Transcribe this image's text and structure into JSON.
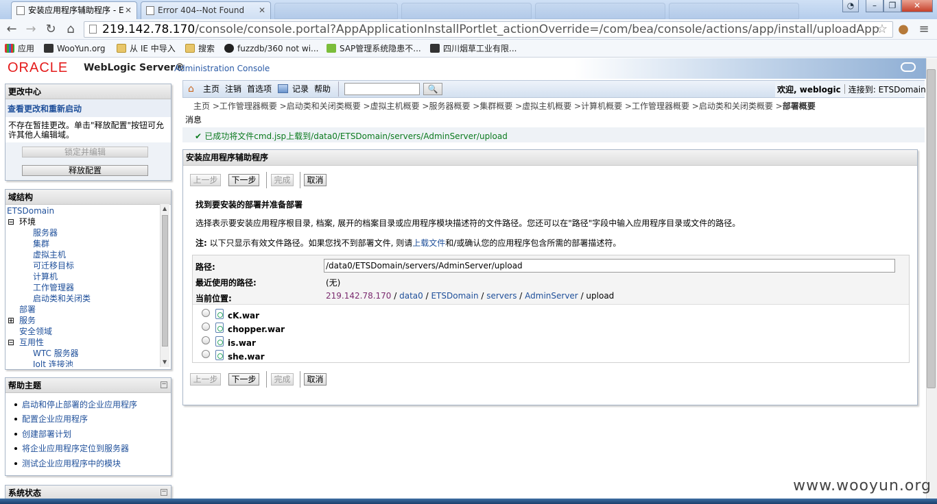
{
  "browser": {
    "tabs": [
      {
        "title": "安装应用程序辅助程序 - E"
      },
      {
        "title": "Error 404--Not Found"
      }
    ],
    "url_host": "219.142.78.170",
    "url_path": "/console/console.portal?AppApplicationInstallPortlet_actionOverride=/com/bea/console/actions/app/install/uploadApp",
    "bookmarks": [
      "应用",
      "WooYun.org",
      "从 IE 中导入",
      "搜索",
      "fuzzdb/360 not wi...",
      "SAP管理系统隐患不...",
      "四川烟草工业有限..."
    ]
  },
  "header": {
    "oracle": "ORACLE",
    "product": "WebLogic Server®",
    "subtitle": "Administration Console"
  },
  "change_center": {
    "title": "更改中心",
    "subtitle": "查看更改和重新启动",
    "text": "不存在暂挂更改。单击\"释放配置\"按钮可允许其他人编辑域。",
    "lock_button": "锁定并编辑",
    "release_button": "释放配置"
  },
  "domain_structure": {
    "title": "域结构",
    "root": "ETSDomain",
    "nodes": [
      "环境",
      "服务器",
      "集群",
      "虚拟主机",
      "可迁移目标",
      "计算机",
      "工作管理器",
      "启动类和关闭类",
      "部署",
      "服务",
      "安全领域",
      "互用性",
      "WTC 服务器",
      "Jolt 连接池"
    ]
  },
  "help_topics": {
    "title": "帮助主题",
    "items": [
      "启动和停止部署的企业应用程序",
      "配置企业应用程序",
      "创建部署计划",
      "将企业应用程序定位到服务器",
      "测试企业应用程序中的模块"
    ]
  },
  "system_status": {
    "title": "系统状态"
  },
  "toolbar": {
    "home": "主页",
    "logout": "注销",
    "preferences": "首选项",
    "record": "记录",
    "help": "帮助",
    "welcome": "欢迎, weblogic",
    "connected": "连接到: ETSDomain"
  },
  "breadcrumb": "主页 >工作管理器概要 >启动类和关闭类概要 >虚拟主机概要 >服务器概要 >集群概要 >虚拟主机概要 >计算机概要 >工作管理器概要 >启动类和关闭类概要 >",
  "breadcrumb_current": "部署概要",
  "messages": {
    "title": "消息",
    "success": "已成功将文件cmd.jsp上载到/data0/ETSDomain/servers/AdminServer/upload"
  },
  "wizard": {
    "title": "安装应用程序辅助程序",
    "buttons": {
      "back": "上一步",
      "next": "下一步",
      "finish": "完成",
      "cancel": "取消"
    },
    "heading": "找到要安装的部署并准备部署",
    "description": "选择表示要安装应用程序根目录, 档案, 展开的档案目录或应用程序模块描述符的文件路径。您还可以在\"路径\"字段中输入应用程序目录或文件的路径。",
    "note_label": "注:",
    "note_text1": "以下只显示有效文件路径。如果您找不到部署文件, 则请",
    "note_link": "上载文件",
    "note_text2": "和/或确认您的应用程序包含所需的部署描述符。",
    "path_label": "路径:",
    "path_value": "/data0/ETSDomain/servers/AdminServer/upload",
    "recent_label": "最近使用的路径:",
    "recent_value": "(无)",
    "current_label": "当前位置:",
    "location": [
      "219.142.78.170",
      "data0",
      "ETSDomain",
      "servers",
      "AdminServer",
      "upload"
    ],
    "files": [
      "cK.war",
      "chopper.war",
      "is.war",
      "she.war"
    ]
  },
  "watermark": "www.wooyun.org",
  "colors": {
    "oracle_red": "#e41b1b",
    "link_blue": "#1e4f9a",
    "success_green": "#0b7a1e"
  }
}
